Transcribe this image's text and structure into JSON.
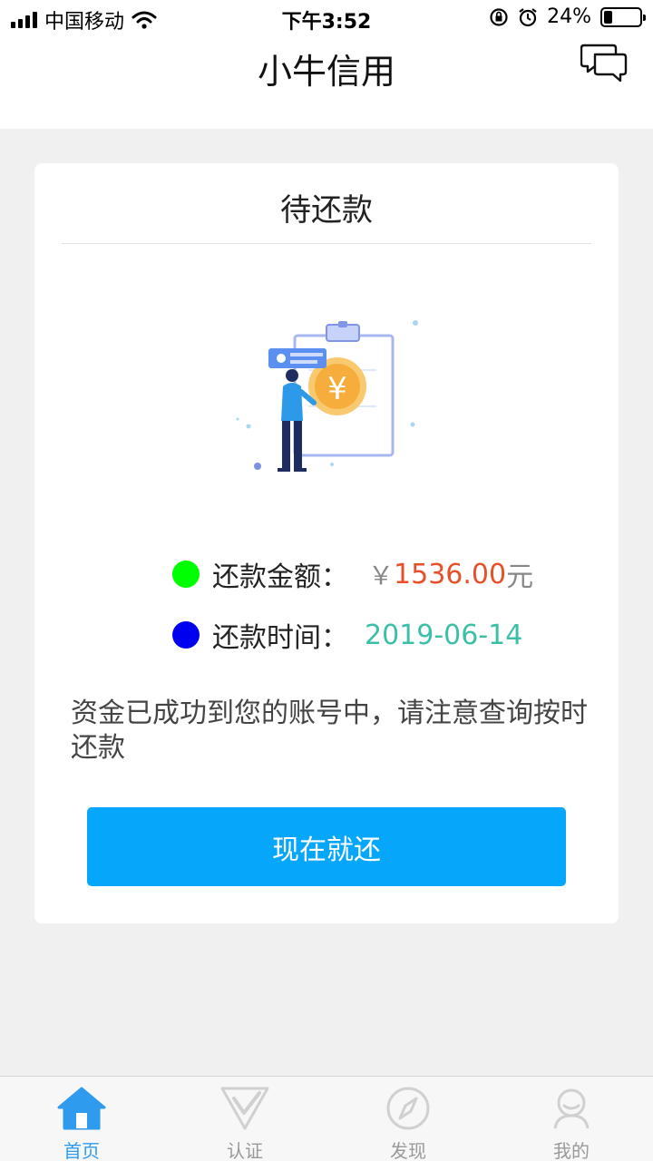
{
  "status_bar": {
    "carrier": "中国移动",
    "time": "下午3:52",
    "battery_percent": "24%",
    "battery_level": 0.24,
    "icons": [
      "signal-icon",
      "wifi-icon",
      "rotation-lock-icon",
      "alarm-icon",
      "battery-icon"
    ]
  },
  "nav": {
    "title": "小牛信用",
    "chat_icon": "chat-bubbles-icon"
  },
  "card": {
    "title": "待还款",
    "amount_row": {
      "label": "还款金额：",
      "currency": "￥",
      "value": "1536.00",
      "unit": "元",
      "dot_color": "#00ff00"
    },
    "date_row": {
      "label": "还款时间：",
      "value": "2019-06-14",
      "dot_color": "#0000ee"
    },
    "notice": "资金已成功到您的账号中，请注意查询按时还款",
    "button_label": "现在就还"
  },
  "tab_bar": {
    "tabs": [
      {
        "label": "首页",
        "icon": "home-icon",
        "active": true
      },
      {
        "label": "认证",
        "icon": "check-shield-icon",
        "active": false
      },
      {
        "label": "发现",
        "icon": "compass-icon",
        "active": false
      },
      {
        "label": "我的",
        "icon": "user-icon",
        "active": false
      }
    ]
  },
  "colors": {
    "accent_blue": "#06a7fb",
    "amount_red": "#e8502a",
    "date_teal": "#3bbfa7",
    "tab_active": "#2e9bef"
  }
}
